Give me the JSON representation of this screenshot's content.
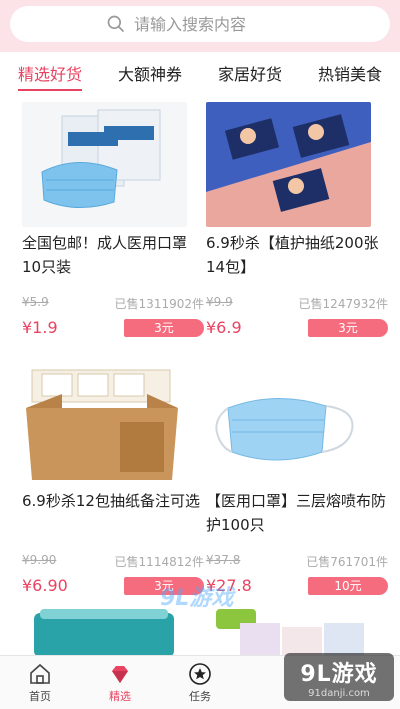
{
  "search": {
    "placeholder": "请输入搜索内容"
  },
  "tabs": [
    {
      "label": "精选好货",
      "active": true
    },
    {
      "label": "大额神券",
      "active": false
    },
    {
      "label": "家居好货",
      "active": false
    },
    {
      "label": "热销美食",
      "active": false
    }
  ],
  "products": [
    {
      "title": "全国包邮！成人医用口罩10只装",
      "old_price": "¥5.9",
      "sold": "已售1311902件",
      "price": "¥1.9",
      "coupon": "3元"
    },
    {
      "title": "6.9秒杀【植护抽纸200张14包】",
      "old_price": "¥9.9",
      "sold": "已售1247932件",
      "price": "¥6.9",
      "coupon": "3元"
    },
    {
      "title": "6.9秒杀12包抽纸备注可选",
      "old_price": "¥9.90",
      "sold": "已售1114812件",
      "price": "¥6.90",
      "coupon": "3元"
    },
    {
      "title": "【医用口罩】三层熔喷布防护100只",
      "old_price": "¥37.8",
      "sold": "已售761701件",
      "price": "¥27.8",
      "coupon": "10元"
    }
  ],
  "nav": [
    {
      "label": "首页",
      "icon": "home-icon",
      "active": false
    },
    {
      "label": "精选",
      "icon": "diamond-icon",
      "active": true
    },
    {
      "label": "任务",
      "icon": "star-icon",
      "active": false
    }
  ],
  "watermark": {
    "line1": "9L游戏",
    "line2": "91danji.com"
  },
  "watermark_center": "9L游戏",
  "colors": {
    "accent": "#e84361",
    "coupon": "#f56c7e",
    "search_bg": "#fbe3e8"
  }
}
